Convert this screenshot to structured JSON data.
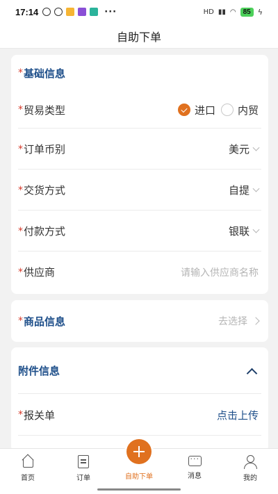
{
  "status_bar": {
    "time": "17:14",
    "network": "HD",
    "battery": "85"
  },
  "nav": {
    "title": "自助下单"
  },
  "required_mark": "*",
  "basic_info": {
    "section_title": "基础信息",
    "trade_type": {
      "label": "贸易类型",
      "options": [
        {
          "label": "进口",
          "checked": true
        },
        {
          "label": "内贸",
          "checked": false
        }
      ]
    },
    "currency": {
      "label": "订单币别",
      "value": "美元"
    },
    "delivery": {
      "label": "交货方式",
      "value": "自提"
    },
    "payment": {
      "label": "付款方式",
      "value": "银联"
    },
    "supplier": {
      "label": "供应商",
      "placeholder": "请输入供应商名称"
    }
  },
  "goods_info": {
    "section_title": "商品信息",
    "action": "去选择"
  },
  "attachments": {
    "section_title": "附件信息",
    "customs": {
      "label": "报关单",
      "action": "点击上传"
    }
  },
  "tabs": [
    {
      "label": "首页",
      "icon": "home-icon"
    },
    {
      "label": "订单",
      "icon": "order-icon"
    },
    {
      "label": "自助下单",
      "icon": "plus-icon"
    },
    {
      "label": "消息",
      "icon": "message-icon"
    },
    {
      "label": "我的",
      "icon": "user-icon"
    }
  ],
  "colors": {
    "accent": "#e0711f",
    "section_title": "#1e4f8a",
    "required": "#d63a2a",
    "background": "#f2f2f2"
  }
}
